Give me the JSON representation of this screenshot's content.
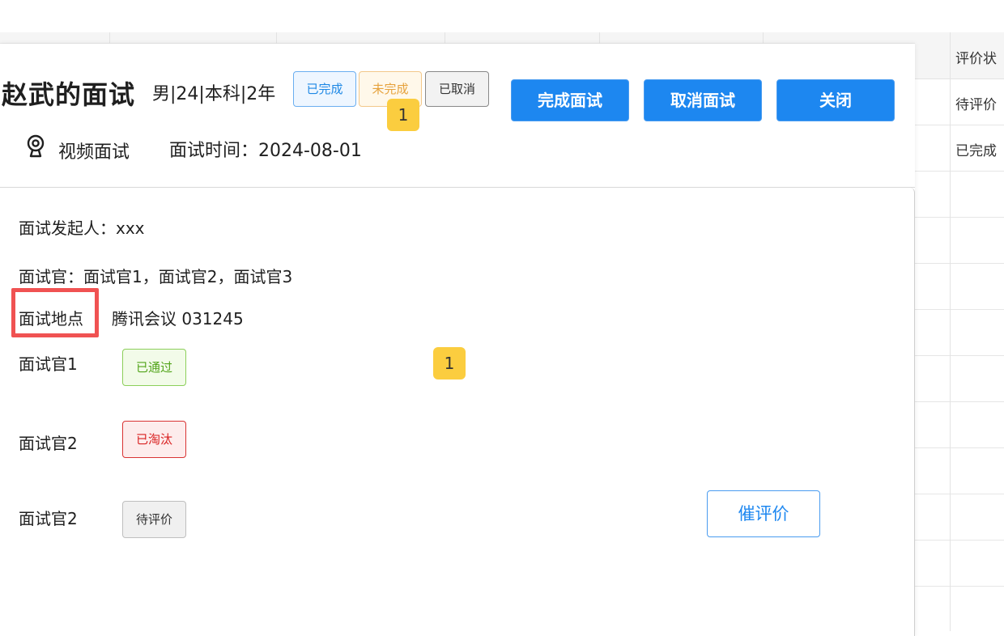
{
  "background_table": {
    "header_label": "评价状",
    "rows": [
      "待评价",
      "已完成",
      "",
      "",
      "",
      "",
      "",
      "",
      "",
      "",
      "",
      ""
    ]
  },
  "modal": {
    "title": "赵武的面试",
    "candidate_meta": "男|24|本科|2年",
    "status_tags": {
      "done": "已完成",
      "undone": "未完成",
      "cancelled": "已取消"
    },
    "badges": {
      "top": "1",
      "middle": "1"
    },
    "buttons": {
      "finish": "完成面试",
      "cancel": "取消面试",
      "close": "关闭",
      "remind": "催评价"
    },
    "interview_type": "视频面试",
    "interview_time": "面试时间：2024-08-01",
    "details": {
      "initiator": "面试发起人：xxx",
      "interviewers": "面试官：面试官1，面试官2，面试官3",
      "location_key": "面试地点",
      "location_value": "腾讯会议  031245"
    },
    "evaluations": [
      {
        "name": "面试官1",
        "status": "已通过"
      },
      {
        "name": "面试官2",
        "status": "已淘汰"
      },
      {
        "name": "面试官2",
        "status": "待评价"
      }
    ]
  },
  "colors": {
    "primary": "#1d87f0",
    "pass": "#52a41a",
    "fail": "#d92121",
    "warning": "#e6a23c",
    "badge": "#fbcd3f",
    "highlight_box": "#f05252"
  },
  "icons": {
    "location": "location-pin-icon"
  }
}
